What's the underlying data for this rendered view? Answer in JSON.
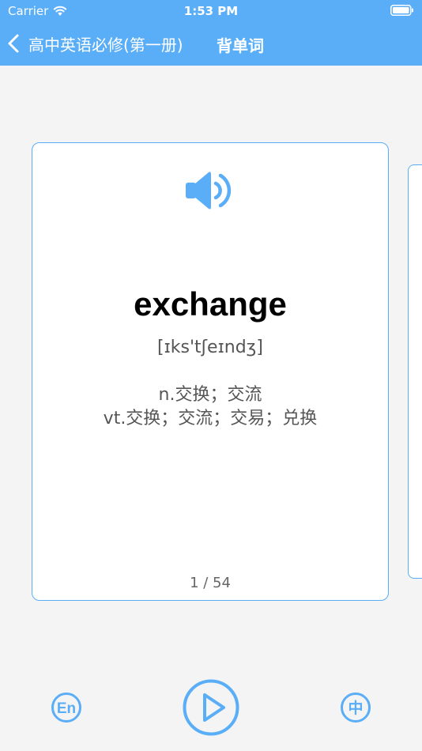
{
  "status_bar": {
    "carrier": "Carrier",
    "time": "1:53 PM"
  },
  "nav": {
    "title": "高中英语必修(第一册)",
    "subtitle": "背单词"
  },
  "card": {
    "word": "exchange",
    "phonetic": "[ɪks'tʃeɪndʒ]",
    "definitions": [
      "n.交换；交流",
      "vt.交换；交流；交易；兑换"
    ],
    "counter": "1 / 54"
  },
  "controls": {
    "en_label": "En",
    "zh_label": "中"
  },
  "colors": {
    "accent": "#5aaef7",
    "background": "#f4f4f4",
    "card": "#ffffff"
  }
}
